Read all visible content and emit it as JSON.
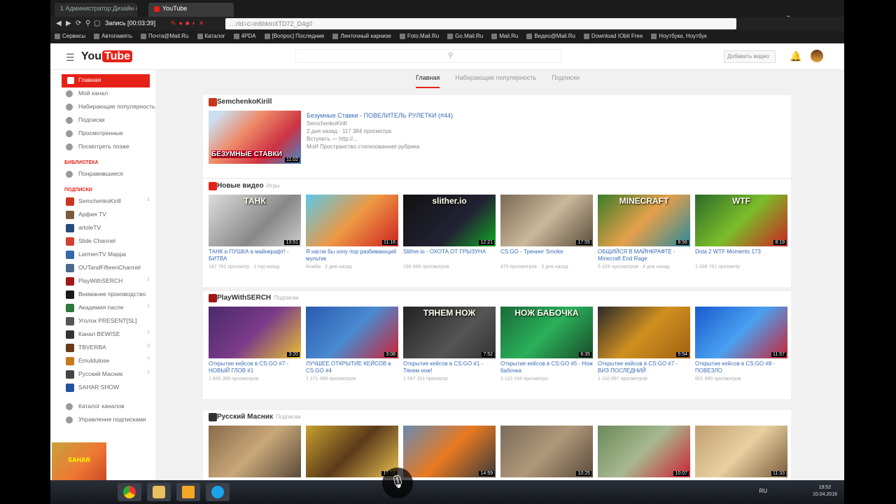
{
  "browser": {
    "tab1_label": "1 Администратор:Дизайн 4.0",
    "tab2_label": "YouTube",
    "recording": "Запись [00:03:39]",
    "url": "…rId=c=in6bktnXTD72_D4g0",
    "bookmarks": [
      "Сервисы",
      "Автопамять",
      "Почта@Mail.Ru",
      "Каталог",
      "4PDA",
      "[Вопрос] Последние",
      "Ленточный карнизе",
      "Foto.Mail.Ru",
      "Go.Mail.Ru",
      "Mail.Ru",
      "Видео@Mail.Ru",
      "Download IObit Free",
      "Ноутбуки, Ноутбук"
    ],
    "overlay_logo": "skype"
  },
  "youtube": {
    "logo_you": "You",
    "logo_tube": "Tube",
    "upload_label": "Добавить видео",
    "tabs": [
      "Главная",
      "Набирающие популярность",
      "Подписки"
    ]
  },
  "sidebar": {
    "items": [
      "Главная",
      "Мой канал",
      "Набирающие популярность",
      "Подписки",
      "Просмотренные",
      "Посмотреть позже"
    ],
    "section_library": "БИБЛИОТЕКА",
    "library_items": [
      "Понравившиеся"
    ],
    "section_subs": "ПОДПИСКИ",
    "subscriptions": [
      {
        "name": "SemchenkoKirill",
        "color": "#c9381e",
        "count": "1"
      },
      {
        "name": "Арфия TV",
        "color": "#7a5b3a",
        "count": ""
      },
      {
        "name": "artoleTV",
        "color": "#2a4b7a",
        "count": ""
      },
      {
        "name": "Slide Channel",
        "color": "#d04030",
        "count": ""
      },
      {
        "name": "LarmenTV Mappa",
        "color": "#3468a8",
        "count": ""
      },
      {
        "name": "OUTandFifteenChannel",
        "color": "#4a6c8a",
        "count": ""
      },
      {
        "name": "PlayWithSERCH",
        "color": "#a01818",
        "count": "1"
      },
      {
        "name": "Внимание производство",
        "color": "#1a1a1a",
        "count": ""
      },
      {
        "name": "Академия паспе",
        "color": "#2d7a3a",
        "count": "1"
      },
      {
        "name": "Уголок PRESENT[SL]",
        "color": "#555555",
        "count": ""
      },
      {
        "name": "Канал BEWISE",
        "color": "#333333",
        "count": "1"
      },
      {
        "name": "TBVERBA",
        "color": "#6a3b1a",
        "count": "3"
      },
      {
        "name": "Emuldulose",
        "color": "#c67a20",
        "count": "7"
      },
      {
        "name": "Русский Масник",
        "color": "#444444",
        "count": "1"
      },
      {
        "name": "SAHAR SHOW",
        "color": "#2452a0",
        "count": ""
      }
    ],
    "bottom_items": [
      "Каталог каналов",
      "Управление подписками"
    ],
    "channel_overlay": "SAHAR"
  },
  "feature": {
    "channel": "SemchenkoKirill",
    "overlay": "БЕЗУМНЫЕ СТАВКИ",
    "title": "Безумные Ставки - ПОВЕЛИТЕЛЬ РУЛЕТКИ (#44)",
    "meta1": "SemchenkoKirill",
    "meta2": "2 дня назад · 117 384 просмотра",
    "meta3": "Вступить — http://...",
    "meta4": "МоИ Пространство стилизованная рубрика",
    "duration": "11:02"
  },
  "sections": [
    {
      "title": "Новые видео",
      "sub": "Игры",
      "icon_color": "#e62117",
      "videos": [
        {
          "title": "ТАНК и ПУШКА в майнкрафт! - БИТВА",
          "meta": "187 781 просмотр · 1 год назад",
          "dur": "13:51",
          "overlay": "ТАНК",
          "bg": "linear-gradient(135deg,#ddd,#888 60%,#ccc)"
        },
        {
          "title": "Я нагла бы хочу пор разбивающий мультик",
          "meta": "Бомба · 2 дня назад",
          "dur": "11:16",
          "overlay": "",
          "bg": "linear-gradient(135deg,#5cc8e6,#e94,#c22)"
        },
        {
          "title": "Slither.io - ОХОТА ОТ ГРЫЗУНА",
          "meta": "155 868 просмотров",
          "dur": "12:21",
          "overlay": "slither.io",
          "bg": "linear-gradient(135deg,#111,#223 60%,#1a2)"
        },
        {
          "title": "CS:GO - Тренинг Smoke",
          "meta": "470 просмотров · 3 дня назад",
          "dur": "17:55",
          "overlay": "",
          "bg": "linear-gradient(135deg,#7b6a55,#c9b89a,#5d4c3b)"
        },
        {
          "title": "ОБЩИЙСЯ В МАЙНКРАФТЕ - Minecraft End Rage",
          "meta": "5 329 просмотров · 4 дня назад",
          "dur": "8:56",
          "overlay": "MINECRAFT",
          "bg": "linear-gradient(135deg,#3a7c2a,#e6a04a,#2a8a9c)"
        },
        {
          "title": "Dota 2 WTF Moments 173",
          "meta": "1 438 761 просмотр",
          "dur": "8:19",
          "overlay": "WTF",
          "bg": "linear-gradient(135deg,#2c6a2a,#7bbd2a,#c22)"
        }
      ]
    },
    {
      "title": "PlayWithSERCH",
      "sub": "Подписки",
      "icon_color": "#a01818",
      "videos": [
        {
          "title": "Открытие кейсов в CS:GO #7 - НОВЫЙ ГЛОВ #1",
          "meta": "1 840 389 просмотров",
          "dur": "3:20",
          "overlay": "",
          "bg": "linear-gradient(135deg,#4a2a6a,#7a3a8a,#e8c030)"
        },
        {
          "title": "ЛУЧШЕЕ ОТКРЫТИЕ КЕЙСОВ в CS:GO #4",
          "meta": "1 271 488 просмотров",
          "dur": "3:08",
          "overlay": "",
          "bg": "linear-gradient(135deg,#2a5ab0,#4a8ad0,#c23)"
        },
        {
          "title": "Открытие кейсов в CS:GO #1 - Тянем нож!",
          "meta": "1 567 351 просмотр",
          "dur": "7:52",
          "overlay": "ТЯНЕМ НОЖ",
          "bg": "linear-gradient(135deg,#222,#555 60%,#333)"
        },
        {
          "title": "Открытие кейсов в CS:GO #5 - Нож бабочка",
          "meta": "1 110 194 просмотра",
          "dur": "6:35",
          "overlay": "НОЖ БАБОЧКА",
          "bg": "linear-gradient(135deg,#1a6a3a,#2ab05a,#1a4a2a)"
        },
        {
          "title": "Открытие кейсов в CS:GO #7 - ВИЗ ПОСЛЕДНИЙ",
          "meta": "1 110 967 просмотров",
          "dur": "5:54",
          "overlay": "",
          "bg": "linear-gradient(135deg,#2a2a2a,#d09020,#a06010)"
        },
        {
          "title": "Открытие кейсов в CS:GO #8 - ПОВЕЗЛО",
          "meta": "801 880 просмотров",
          "dur": "11:57",
          "overlay": "",
          "bg": "linear-gradient(135deg,#1a5ad0,#4aa0f0,#c23)"
        }
      ]
    },
    {
      "title": "Русский Масник",
      "sub": "Подписки",
      "icon_color": "#333333",
      "videos": [
        {
          "title": "",
          "meta": "",
          "dur": "",
          "overlay": "",
          "bg": "linear-gradient(135deg,#8a6a4a,#c8a878,#5a4a3a)"
        },
        {
          "title": "",
          "meta": "",
          "dur": "10:58",
          "overlay": "",
          "bg": "linear-gradient(135deg,#c8a030,#5a3a1a,#e8c050)"
        },
        {
          "title": "",
          "meta": "",
          "dur": "14:59",
          "overlay": "",
          "bg": "linear-gradient(135deg,#6a8ab0,#e87a20,#3a3a3a)"
        },
        {
          "title": "",
          "meta": "",
          "dur": "10:25",
          "overlay": "",
          "bg": "linear-gradient(135deg,#7a6a5a,#b0987a,#5a4a3a)"
        },
        {
          "title": "",
          "meta": "",
          "dur": "10:07",
          "overlay": "",
          "bg": "linear-gradient(135deg,#6a8a5a,#a8b890,#c23)"
        },
        {
          "title": "",
          "meta": "",
          "dur": "11:33",
          "overlay": "",
          "bg": "linear-gradient(135deg,#c0a070,#e8d0a0,#7a5a3a)"
        }
      ]
    }
  ],
  "taskbar": {
    "lang": "RU",
    "clock_time": "19:52",
    "clock_date": "10.04.2016"
  }
}
